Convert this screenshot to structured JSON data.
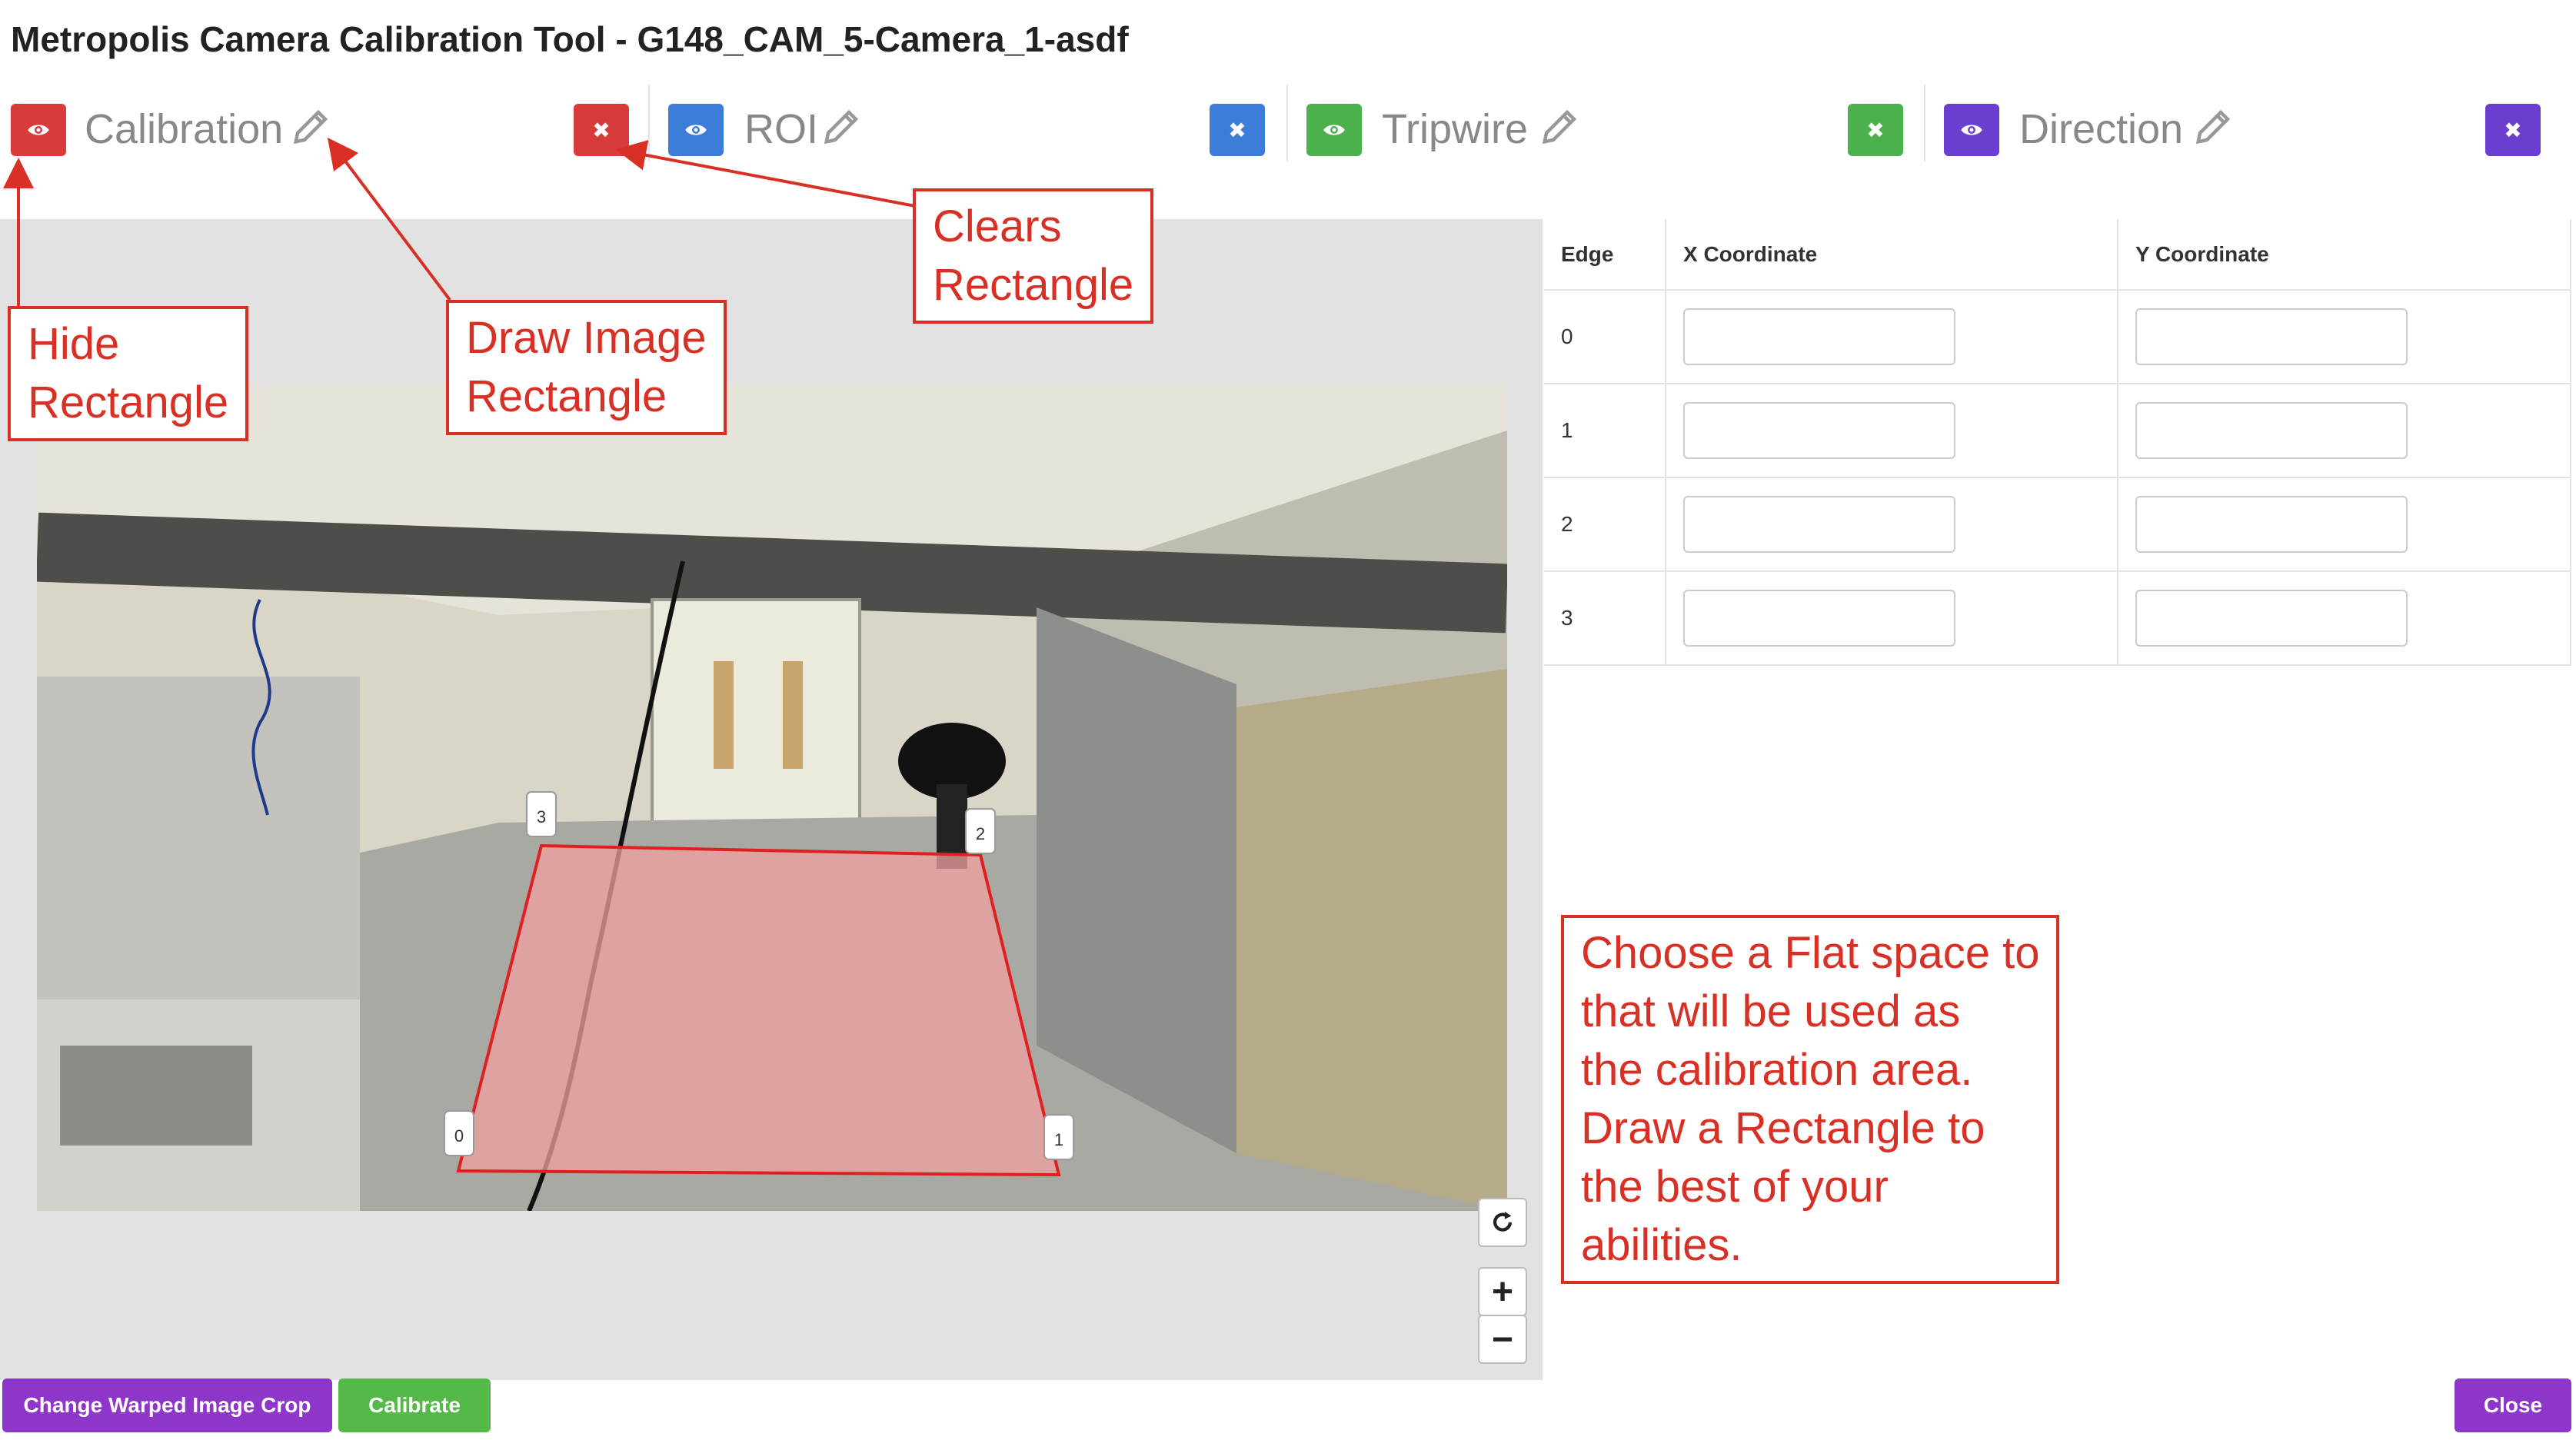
{
  "window": {
    "title": "Metropolis Camera Calibration Tool - G148_CAM_5-Camera_1-asdf"
  },
  "toolbar": {
    "sections": [
      {
        "label": "Calibration",
        "color": "#d93a3a"
      },
      {
        "label": "ROI",
        "color": "#3b7dd8"
      },
      {
        "label": "Tripwire",
        "color": "#4cb14c"
      },
      {
        "label": "Direction",
        "color": "#6a3fd0"
      }
    ]
  },
  "table": {
    "headers": [
      "Edge",
      "X Coordinate",
      "Y Coordinate"
    ],
    "rows": [
      {
        "edge": "0",
        "x": "",
        "y": ""
      },
      {
        "edge": "1",
        "x": "",
        "y": ""
      },
      {
        "edge": "2",
        "x": "",
        "y": ""
      },
      {
        "edge": "3",
        "x": "",
        "y": ""
      }
    ]
  },
  "polygon": {
    "markers": [
      "0",
      "1",
      "2",
      "3"
    ],
    "fill_color": "#f0a0a0",
    "stroke_color": "#e02020"
  },
  "annotations": {
    "hide_rectangle": "Hide\nRectangle",
    "draw_image_rectangle": "Draw Image\nRectangle",
    "clears_rectangle": "Clears\nRectangle",
    "instructions": "Choose a Flat space to\nthat will be used as\nthe calibration area.\nDraw a Rectangle to\nthe best of your\nabilities.",
    "color": "#d93025"
  },
  "map_controls": {
    "reset_icon": "refresh-icon",
    "zoom_in": "+",
    "zoom_out": "−"
  },
  "buttons": {
    "change_crop": "Change Warped Image Crop",
    "calibrate": "Calibrate",
    "close": "Close",
    "change_crop_color": "#8e36c9",
    "calibrate_color": "#54b948",
    "close_color": "#8e36c9"
  }
}
